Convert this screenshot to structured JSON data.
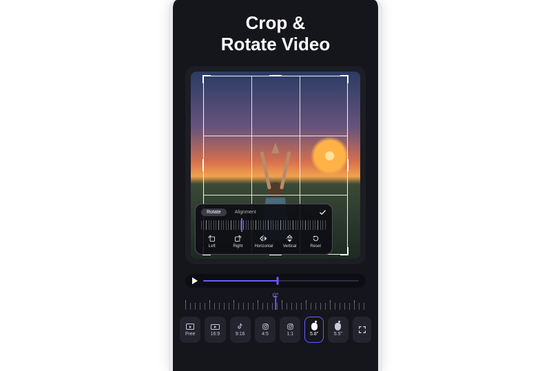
{
  "title_line1": "Crop &",
  "title_line2": "Rotate Video",
  "panel": {
    "tabs": {
      "rotate": "Rotate",
      "alignment": "Alignment"
    },
    "tools": {
      "left": "Left",
      "right": "Right",
      "horizontal": "Horizontal",
      "vertical": "Vertical",
      "reset": "Reset"
    }
  },
  "ruler": {
    "degree": "0°"
  },
  "ratios": {
    "free": "Free",
    "r169": "16:9",
    "r916": "9:16",
    "r45": "4:5",
    "r11": "1:1",
    "r58a": "5.8\"",
    "r55a": "5.5\""
  },
  "colors": {
    "accent": "#6a5cff"
  }
}
